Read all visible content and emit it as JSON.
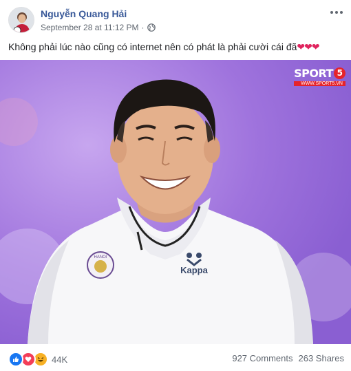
{
  "post": {
    "author": "Nguyễn Quang Hải",
    "timestamp": "September 28 at 11:12 PM",
    "separator": "·",
    "privacy_icon": "globe-icon",
    "caption": "Không phải lúc nào cũng có internet nên có phát là phải cười cái đã",
    "caption_emoji": "❤❤❤",
    "more_icon": "more-options-icon"
  },
  "photo": {
    "watermark_main": "SPORT",
    "watermark_number": "5",
    "watermark_url": "WWW.SPORT5.VN",
    "shirt_brand": "Kappa",
    "badge_text": "HANOI"
  },
  "footer": {
    "reaction_icons": [
      "like-icon",
      "love-icon",
      "haha-icon"
    ],
    "reaction_count": "44K",
    "comments": "927 Comments",
    "shares": "263 Shares"
  },
  "colors": {
    "link": "#385898",
    "secondary_text": "#606770",
    "heart": "#e0245e",
    "like": "#1877f2",
    "love": "#f33e58",
    "haha": "#f7b125",
    "photo_background": "#a57ae0"
  }
}
